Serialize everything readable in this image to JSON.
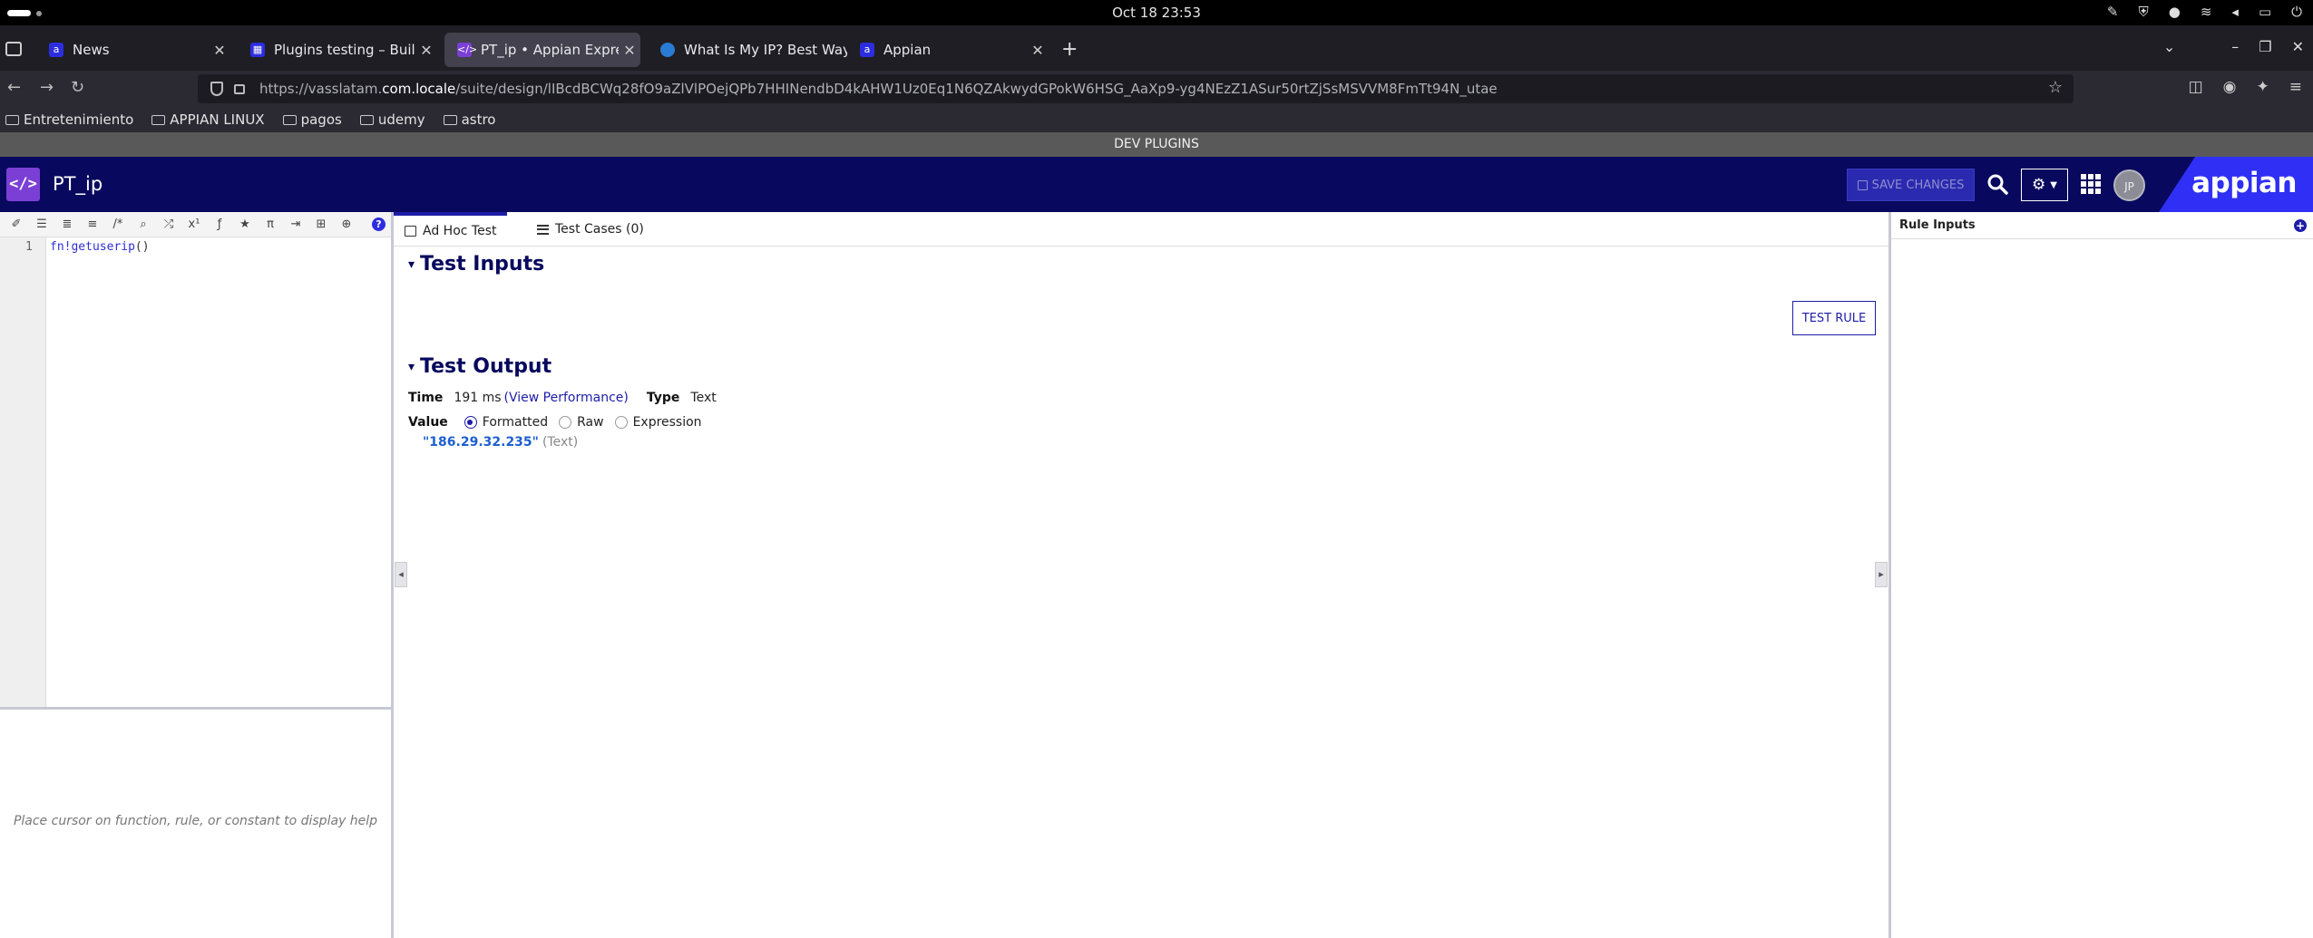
{
  "system": {
    "clock": "Oct 18  23:53"
  },
  "browser": {
    "tabs": [
      {
        "title": "News",
        "favicon": "appian-a",
        "color": "#2d2de0",
        "active": false
      },
      {
        "title": "Plugins testing – Build ·",
        "favicon": "appian-grid",
        "color": "#2d2de0",
        "active": false
      },
      {
        "title": "PT_ip • Appian Expression",
        "favicon": "code-icon",
        "color": "#7b3fd6",
        "active": true
      },
      {
        "title": "What Is My IP? Best Way T",
        "favicon": "globe",
        "color": "#2a7bd4",
        "active": false
      },
      {
        "title": "Appian",
        "favicon": "appian-a",
        "color": "#2d2de0",
        "active": false
      }
    ],
    "url_prefix": "https://vasslatam.",
    "url_host": "com.locale",
    "url_path": "/suite/design/lIBcdBCWq28fO9aZlVlPOejQPb7HHINendbD4kAHW1Uz0Eq1N6QZAkwydGPokW6HSG_AaXp9-yg4NEzZ1ASur50rtZjSsMSVVM8FmTt94N_utae",
    "bookmarks": [
      "Entretenimiento",
      "APPIAN LINUX",
      "pagos",
      "udemy",
      "astro"
    ]
  },
  "env_banner": "DEV PLUGINS",
  "header": {
    "object_title": "PT_ip",
    "save_label": "SAVE CHANGES",
    "avatar_initials": "JP",
    "logo_text": "appian",
    "accent": "#2f2ff5",
    "bg": "#08085e"
  },
  "editor": {
    "line_number": "1",
    "code_fn": "fn!getuserip",
    "code_paren": "()",
    "help_placeholder": "Place cursor on function, rule, or constant to display help"
  },
  "test_panel": {
    "tab_adhoc": "Ad Hoc Test",
    "tab_cases": "Test Cases (0)",
    "test_inputs_heading": "Test Inputs",
    "test_rule_label": "TEST RULE",
    "test_output_heading": "Test Output",
    "time_label": "Time",
    "time_value": "191 ms",
    "view_performance": "(View Performance)",
    "type_label": "Type",
    "type_value": "Text",
    "value_label": "Value",
    "radio_formatted": "Formatted",
    "radio_raw": "Raw",
    "radio_expression": "Expression",
    "selected_format": "Formatted",
    "output_value": "\"186.29.32.235\"",
    "output_type": "(Text)"
  },
  "rule_inputs": {
    "title": "Rule Inputs"
  }
}
